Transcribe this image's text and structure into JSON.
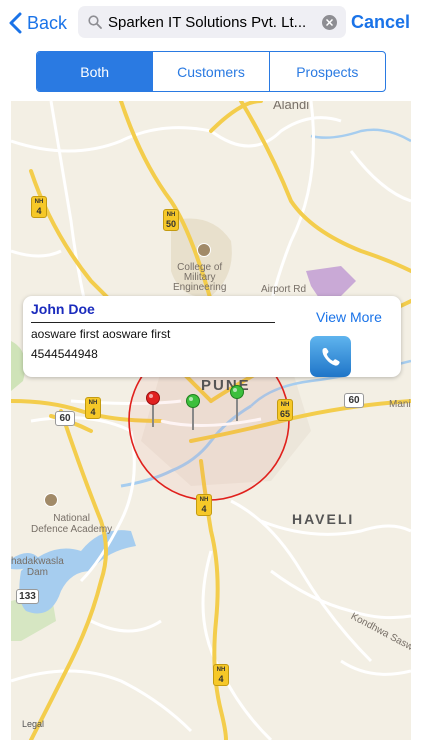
{
  "navbar": {
    "back_label": "Back",
    "search_value": "Sparken IT Solutions Pvt. Lt...",
    "cancel_label": "Cancel"
  },
  "segment": {
    "options": [
      "Both",
      "Customers",
      "Prospects"
    ],
    "selected": "Both"
  },
  "map": {
    "labels": {
      "alandi": "Alandi",
      "college": "College of\nMilitary\nEngineering",
      "airport_rd": "Airport Rd",
      "city": "PUNE",
      "haveli": "HAVELI",
      "nda": "National\nDefence Academy",
      "dam": "hadakwasla\nDam",
      "kondhwa": "Kondhwa Sasw",
      "mani": "Mani"
    },
    "highways": {
      "nh4_a": "4",
      "nh50": "50",
      "nh4_b": "4",
      "nh65": "65",
      "nh4_c": "4",
      "nh4_d": "4"
    },
    "highway_prefix": "NH",
    "shields": {
      "r60_a": "60",
      "r60_b": "60",
      "r133": "133"
    },
    "legal_label": "Legal"
  },
  "callout": {
    "name": "John Doe",
    "address": "aosware first aosware first",
    "phone": "4544544948",
    "view_more_label": "View More"
  },
  "colors": {
    "accent": "#1a73e8",
    "segment": "#2a7ae2",
    "name": "#1a2bbd",
    "radius_circle": "#e0201c",
    "pin_red": "#e02020",
    "pin_green": "#3cbf3c"
  }
}
